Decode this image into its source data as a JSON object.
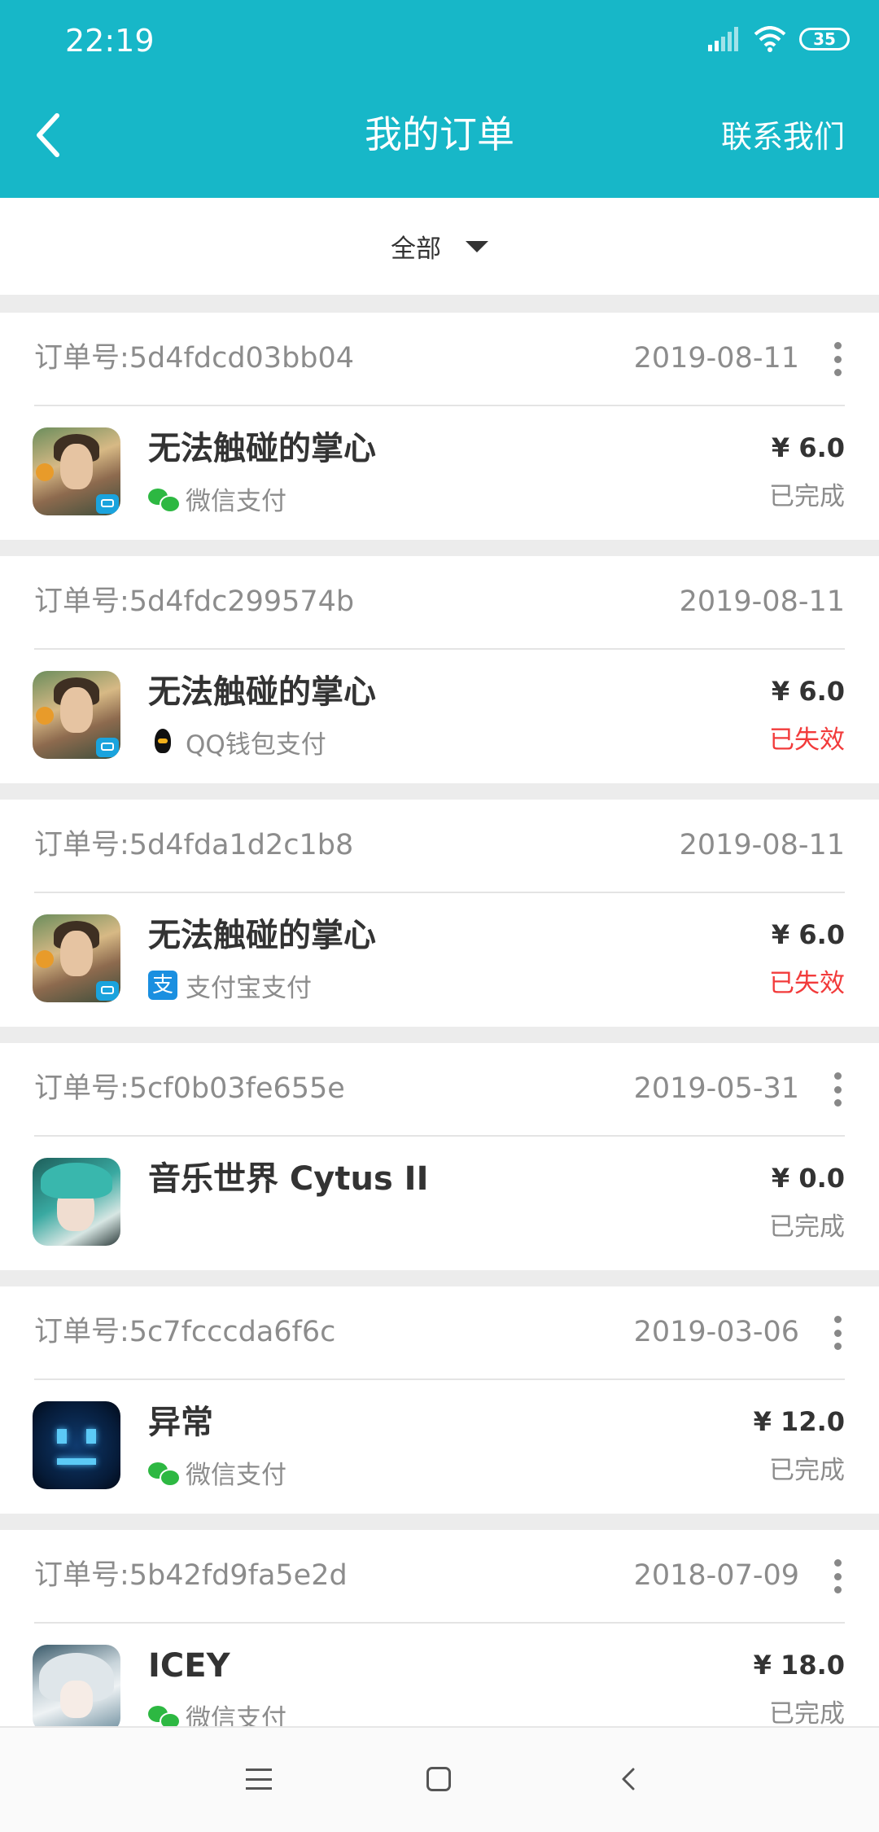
{
  "status_bar": {
    "time": "22:19",
    "battery": "35",
    "icons": [
      "signal-icon",
      "wifi-icon",
      "battery-icon"
    ]
  },
  "header": {
    "title": "我的订单",
    "contact_label": "联系我们",
    "back_icon": "chevron-left-icon"
  },
  "filter": {
    "label": "全部",
    "icon": "dropdown-caret-icon"
  },
  "orders": [
    {
      "order_label": "订单号:5d4fdcd03bb04",
      "date": "2019-08-11",
      "game": "无法触碰的掌心",
      "payment": "微信支付",
      "price": "¥ 6.0",
      "status": "已完成"
    },
    {
      "order_label": "订单号:5d4fdc299574b",
      "date": "2019-08-11",
      "game": "无法触碰的掌心",
      "payment": "QQ钱包支付",
      "price": "¥ 6.0",
      "status": "已失效"
    },
    {
      "order_label": "订单号:5d4fda1d2c1b8",
      "date": "2019-08-11",
      "game": "无法触碰的掌心",
      "payment": "支付宝支付",
      "price": "¥ 6.0",
      "status": "已失效"
    },
    {
      "order_label": "订单号:5cf0b03fe655e",
      "date": "2019-05-31",
      "game": "音乐世界 Cytus II",
      "payment": "",
      "price": "¥ 0.0",
      "status": "已完成"
    },
    {
      "order_label": "订单号:5c7fcccda6f6c",
      "date": "2019-03-06",
      "game": "异常",
      "payment": "微信支付",
      "price": "¥ 12.0",
      "status": "已完成"
    },
    {
      "order_label": "订单号:5b42fd9fa5e2d",
      "date": "2018-07-09",
      "game": "ICEY",
      "payment": "微信支付",
      "price": "¥ 18.0",
      "status": "已完成"
    }
  ],
  "colors": {
    "header": "#17b7c8",
    "expired": "#f23b3b",
    "wechat": "#2db842",
    "alipay": "#1a8fe0"
  },
  "alipay_glyph": "支"
}
